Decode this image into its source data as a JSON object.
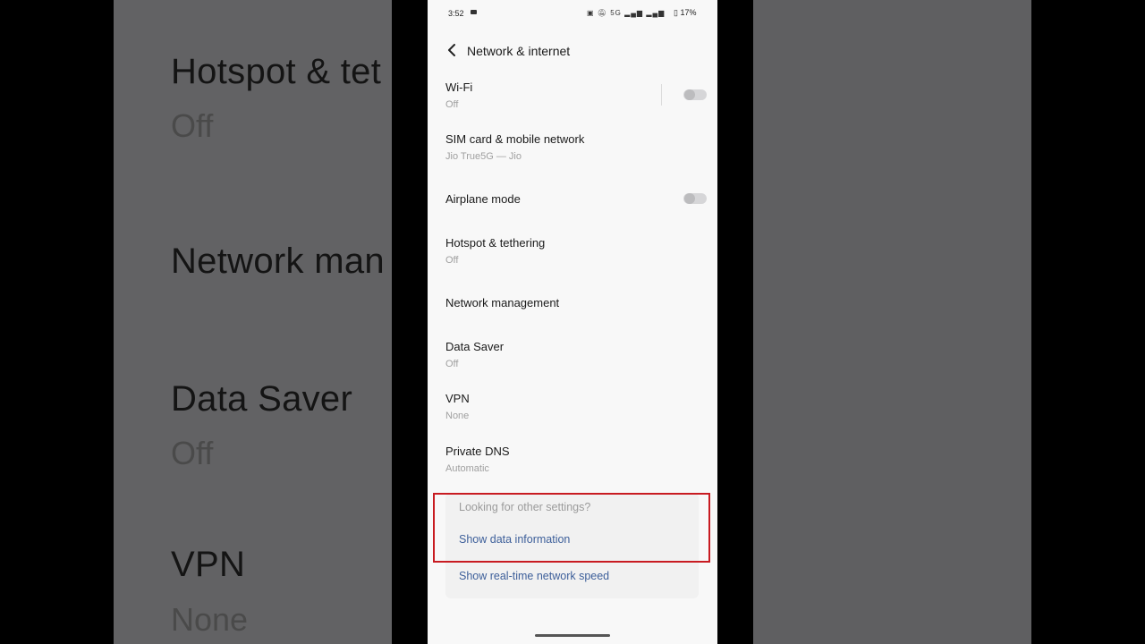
{
  "status_bar": {
    "time": "3:52",
    "icons": "5G",
    "battery": "17%"
  },
  "header": {
    "title": "Network & internet"
  },
  "settings": [
    {
      "title": "Wi-Fi",
      "subtitle": "Off",
      "toggle": "off"
    },
    {
      "title": "SIM card & mobile network",
      "subtitle": "Jio True5G — Jio"
    },
    {
      "title": "Airplane mode",
      "toggle": "off"
    },
    {
      "title": "Hotspot & tethering",
      "subtitle": "Off"
    },
    {
      "title": "Network management"
    },
    {
      "title": "Data Saver",
      "subtitle": "Off"
    },
    {
      "title": "VPN",
      "subtitle": "None"
    },
    {
      "title": "Private DNS",
      "subtitle": "Automatic"
    }
  ],
  "other_settings": {
    "hint": "Looking for other settings?",
    "links": [
      "Show data information",
      "Show real-time network speed"
    ]
  },
  "background_zoom": {
    "items": [
      {
        "title": "Hotspot & tet",
        "subtitle": "Off"
      },
      {
        "title": "Network man"
      },
      {
        "title": "Data Saver",
        "subtitle": "Off"
      },
      {
        "title": "VPN",
        "subtitle": "None"
      }
    ]
  },
  "colors": {
    "accent_link": "#3d5f9a",
    "highlight": "#c81b21",
    "screen_bg": "#f8f8f8"
  }
}
